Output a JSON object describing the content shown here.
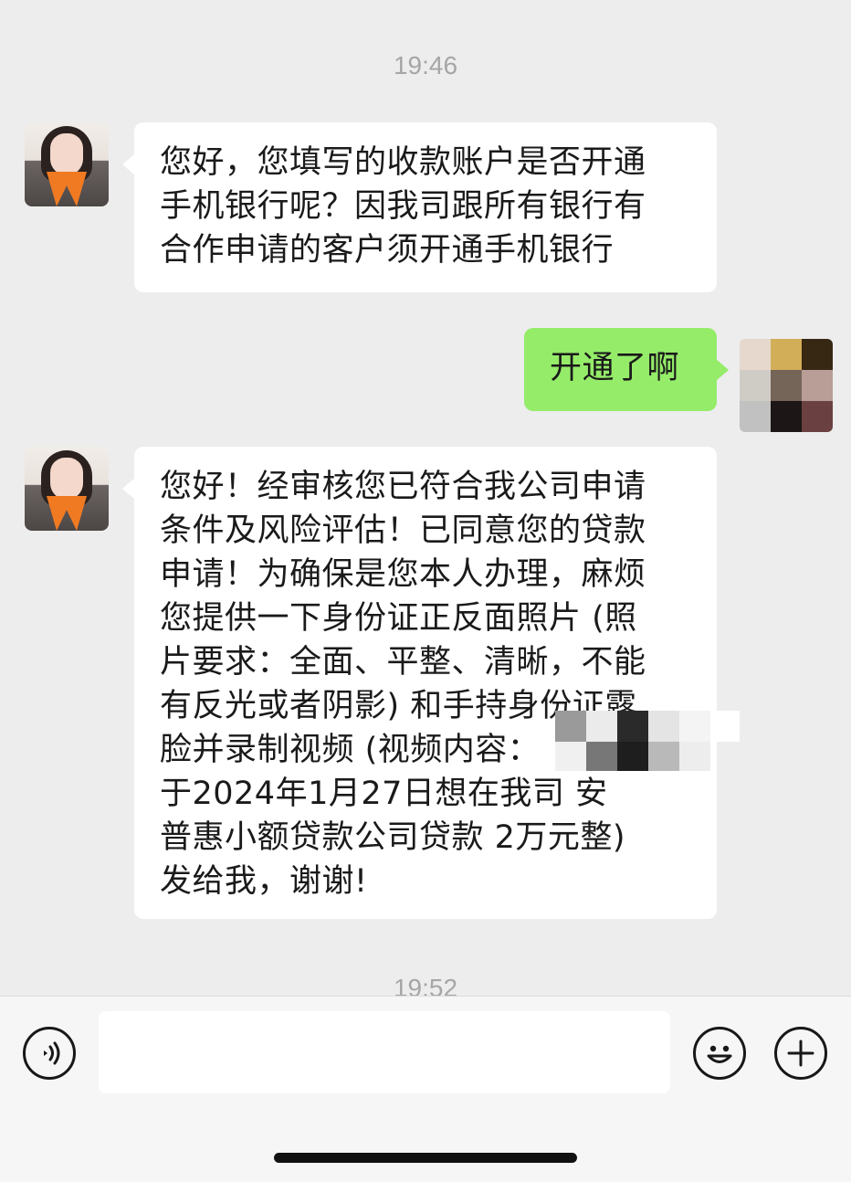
{
  "timestamps": {
    "first": "19:46",
    "second": "19:52"
  },
  "messages": [
    {
      "sender": "contact",
      "lines": [
        "您好，您填写的收款账户是否开通",
        "手机银行呢？因我司跟所有银行有",
        "合作申请的客户须开通手机银行"
      ]
    },
    {
      "sender": "me",
      "lines": [
        "开通了啊"
      ]
    },
    {
      "sender": "contact",
      "lines": [
        "您好！经审核您已符合我公司申请",
        "条件及风险评估！已同意您的贷款",
        "申请！为确保是您本人办理，麻烦",
        "您提供一下身份证正反面照片 (照",
        "片要求：全面、平整、清晰，不能",
        "有反光或者阴影) 和手持身份证露",
        "脸并录制视频 (视频内容：",
        "于2024年1月27日想在我司 安",
        "普惠小额贷款公司贷款 2万元整)",
        "发给我，谢谢!"
      ]
    }
  ],
  "input_bar": {
    "message_value": ""
  },
  "icons": {
    "voice": "voice-input-icon",
    "emoji": "emoji-icon",
    "more": "plus-icon"
  },
  "colors": {
    "background": "#ededed",
    "sent_bubble": "#95ec69",
    "received_bubble": "#ffffff",
    "timestamp": "#a6a6a6"
  }
}
